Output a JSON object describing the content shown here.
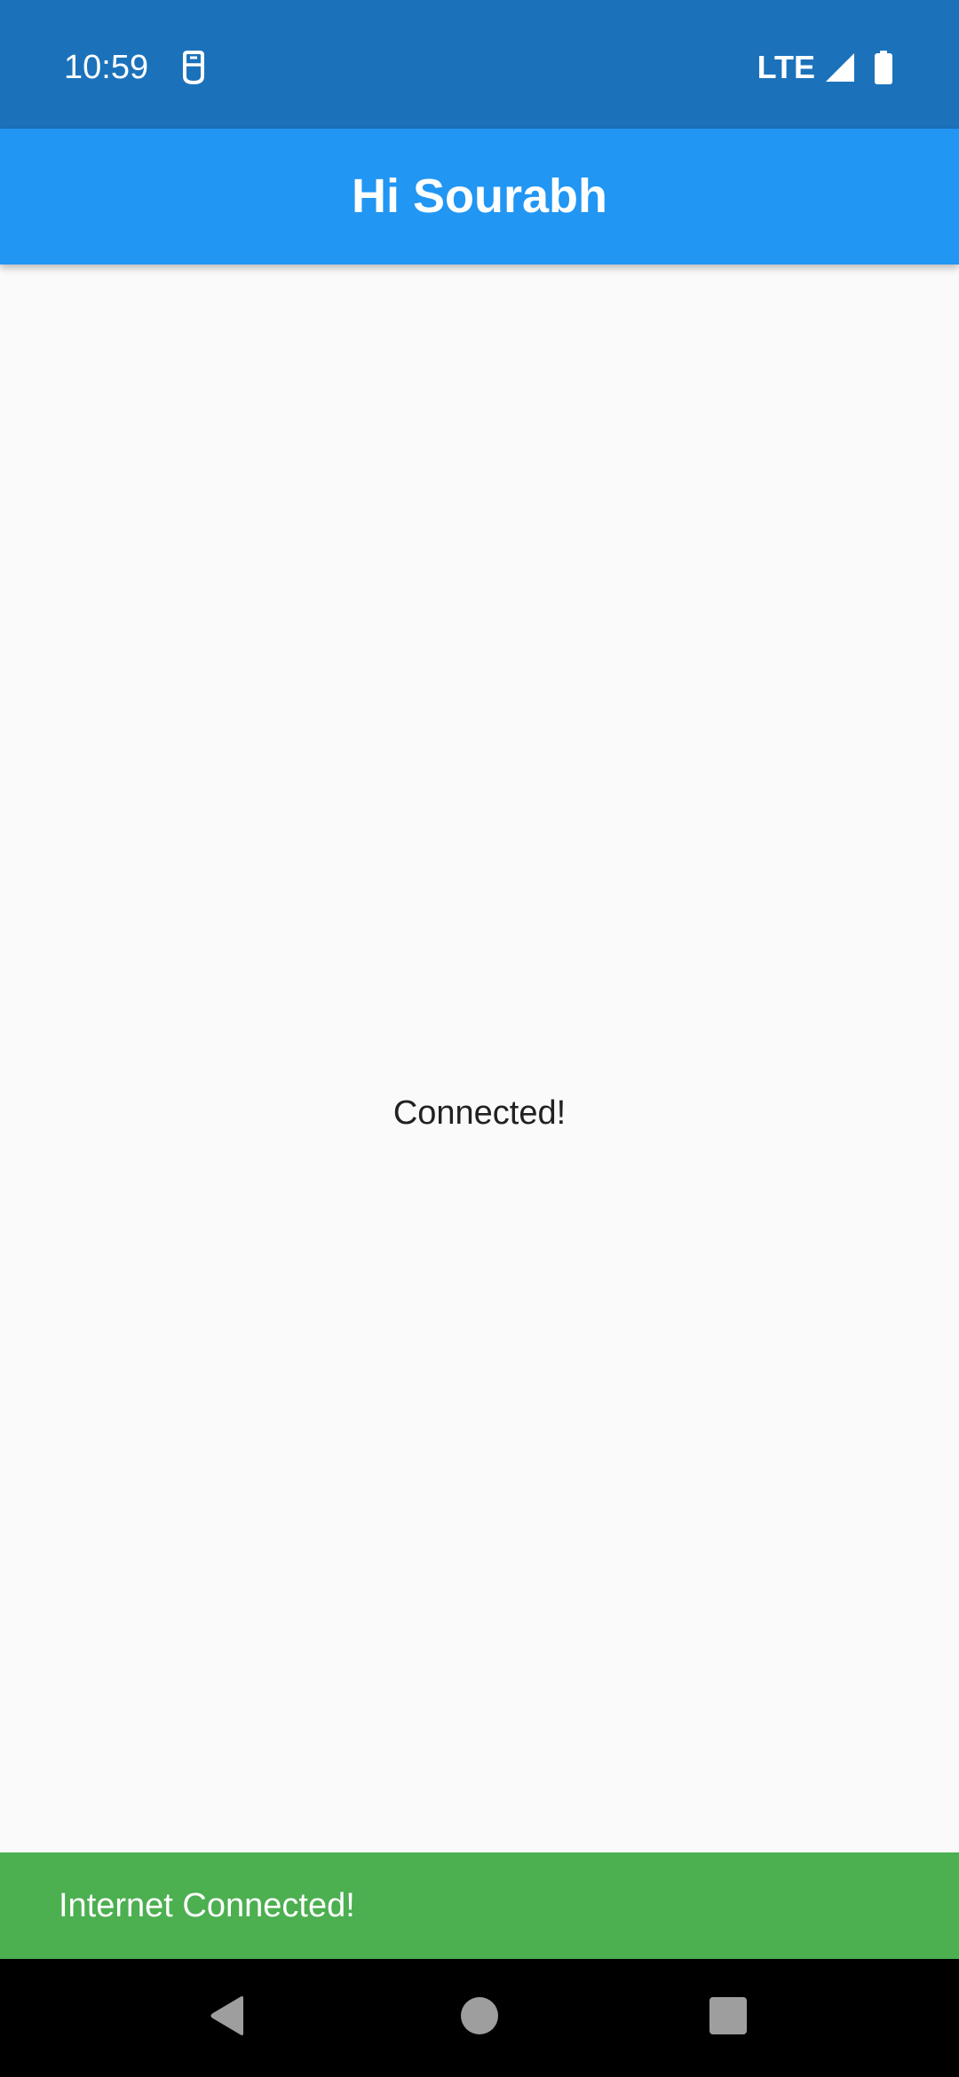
{
  "status_bar": {
    "time": "10:59",
    "network": "LTE",
    "notification_icon": "sim-card-icon",
    "signal_icon": "cellular-signal-icon",
    "battery_icon": "battery-full-icon",
    "background_color": "#1b72bb"
  },
  "app_bar": {
    "title": "Hi Sourabh",
    "background_color": "#2196f3"
  },
  "main": {
    "status_text": "Connected!"
  },
  "snackbar": {
    "message": "Internet Connected!",
    "background_color": "#4caf50"
  },
  "nav_bar": {
    "back_icon": "back-triangle-icon",
    "home_icon": "home-circle-icon",
    "recents_icon": "recents-square-icon"
  }
}
